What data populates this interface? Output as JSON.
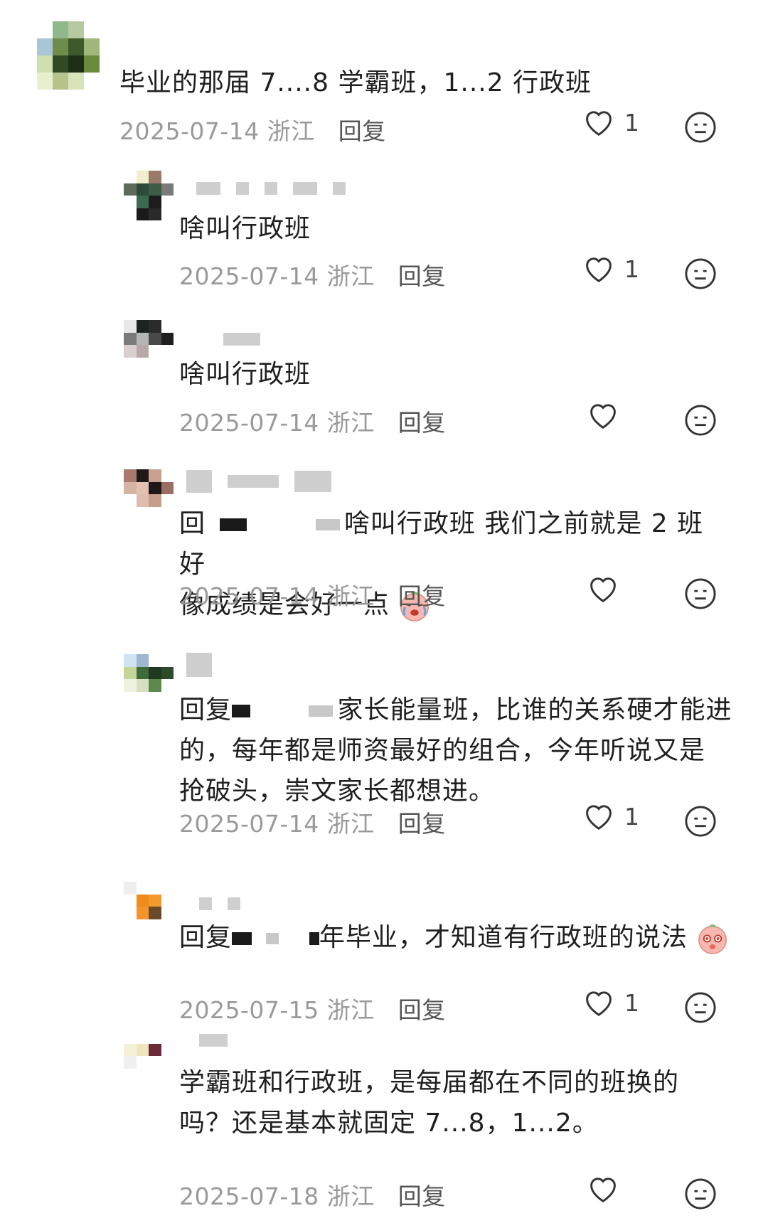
{
  "comments": [
    {
      "text": "毕业的那届 7....8 学霸班，1...2 行政班",
      "date": "2025-07-14",
      "location": "浙江",
      "reply_label": "回复",
      "likes": "1",
      "icons": {
        "like": "heart-outline-icon",
        "dislike": "neutral-face-icon"
      }
    },
    {
      "text": "啥叫行政班",
      "date": "2025-07-14",
      "location": "浙江",
      "reply_label": "回复",
      "likes": "1"
    },
    {
      "text": "啥叫行政班",
      "date": "2025-07-14",
      "location": "浙江",
      "reply_label": "回复",
      "likes": ""
    },
    {
      "prefix": "回",
      "text_line1": "啥叫行政班 我们之前就是 2 班 好",
      "text_line2": "像成绩是会好一点",
      "emoji": "crying-face-emoji",
      "date": "2025-07-14",
      "location": "浙江",
      "reply_label": "回复",
      "likes": ""
    },
    {
      "prefix": "回复",
      "text_line1": "家长能量班，比谁的关系硬才能进",
      "text_line2": "的，每年都是师资最好的组合，今年听说又是",
      "text_line3": "抢破头，崇文家长都想进。",
      "date": "2025-07-14",
      "location": "浙江",
      "reply_label": "回复",
      "likes": "1"
    },
    {
      "prefix": "回复",
      "text_line1": "年毕业，才知道有行政班的说法",
      "emoji": "shy-face-emoji",
      "date": "2025-07-15",
      "location": "浙江",
      "reply_label": "回复",
      "likes": "1"
    },
    {
      "text_line1": "学霸班和行政班，是每届都在不同的班换的",
      "text_line2": "吗？还是基本就固定 7...8，1...2。",
      "date": "2025-07-18",
      "location": "浙江",
      "reply_label": "回复",
      "likes": ""
    }
  ],
  "colors": {
    "text": "#1f1f1f",
    "meta": "#9a9a9a",
    "reply": "#555555",
    "icon": "#333333"
  }
}
